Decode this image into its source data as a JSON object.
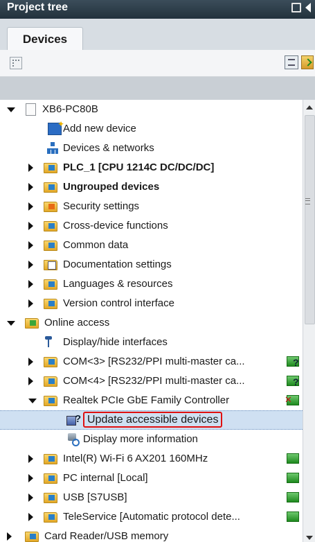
{
  "panel": {
    "title": "Project tree"
  },
  "tabs": [
    {
      "label": "Devices"
    }
  ],
  "tree": [
    {
      "label": "XB6-PC80B",
      "icon": "file-icon",
      "expander": "expanded",
      "bold": false,
      "selected": false,
      "status_icon": null
    },
    {
      "label": "Add new device",
      "icon": "add-device-icon",
      "expander": null,
      "bold": false,
      "selected": false,
      "status_icon": null
    },
    {
      "label": "Devices & networks",
      "icon": "network-icon",
      "expander": null,
      "bold": false,
      "selected": false,
      "status_icon": null
    },
    {
      "label": "PLC_1 [CPU 1214C DC/DC/DC]",
      "icon": "plc-icon",
      "expander": "collapsed",
      "bold": true,
      "selected": false,
      "status_icon": null
    },
    {
      "label": "Ungrouped devices",
      "icon": "ungrouped-devices-icon",
      "expander": "collapsed",
      "bold": true,
      "selected": false,
      "status_icon": null
    },
    {
      "label": "Security settings",
      "icon": "security-icon",
      "expander": "collapsed",
      "bold": false,
      "selected": false,
      "status_icon": null
    },
    {
      "label": "Cross-device functions",
      "icon": "cross-device-icon",
      "expander": "collapsed",
      "bold": false,
      "selected": false,
      "status_icon": null
    },
    {
      "label": "Common data",
      "icon": "common-data-icon",
      "expander": "collapsed",
      "bold": false,
      "selected": false,
      "status_icon": null
    },
    {
      "label": "Documentation settings",
      "icon": "documentation-icon",
      "expander": "collapsed",
      "bold": false,
      "selected": false,
      "status_icon": null
    },
    {
      "label": "Languages & resources",
      "icon": "languages-icon",
      "expander": "collapsed",
      "bold": false,
      "selected": false,
      "status_icon": null
    },
    {
      "label": "Version control interface",
      "icon": "version-control-icon",
      "expander": "collapsed",
      "bold": false,
      "selected": false,
      "status_icon": null
    },
    {
      "label": "Online access",
      "icon": "online-access-icon",
      "expander": "expanded",
      "bold": false,
      "selected": false,
      "status_icon": null
    },
    {
      "label": "Display/hide interfaces",
      "icon": "interface-icon",
      "expander": null,
      "bold": false,
      "selected": false,
      "status_icon": null
    },
    {
      "label": "COM<3> [RS232/PPI multi-master ca...",
      "icon": "folder-icon",
      "expander": "collapsed",
      "bold": false,
      "selected": false,
      "status_icon": "unknown-status-icon"
    },
    {
      "label": "COM<4> [RS232/PPI multi-master ca...",
      "icon": "folder-icon",
      "expander": "collapsed",
      "bold": false,
      "selected": false,
      "status_icon": "unknown-status-icon"
    },
    {
      "label": "Realtek PCIe GbE Family Controller",
      "icon": "folder-icon",
      "expander": "expanded",
      "bold": false,
      "selected": false,
      "status_icon": "disconnected-status-icon"
    },
    {
      "label": "Update accessible devices",
      "icon": "update-devices-icon",
      "expander": null,
      "bold": false,
      "selected": true,
      "status_icon": null
    },
    {
      "label": "Display more information",
      "icon": "info-icon",
      "expander": null,
      "bold": false,
      "selected": false,
      "status_icon": null
    },
    {
      "label": "Intel(R) Wi-Fi 6 AX201 160MHz",
      "icon": "folder-icon",
      "expander": "collapsed",
      "bold": false,
      "selected": false,
      "status_icon": "connected-status-icon"
    },
    {
      "label": "PC internal [Local]",
      "icon": "folder-icon",
      "expander": "collapsed",
      "bold": false,
      "selected": false,
      "status_icon": "connected-status-icon"
    },
    {
      "label": "USB [S7USB]",
      "icon": "folder-icon",
      "expander": "collapsed",
      "bold": false,
      "selected": false,
      "status_icon": "connected-status-icon"
    },
    {
      "label": "TeleService [Automatic protocol dete...",
      "icon": "folder-icon",
      "expander": "collapsed",
      "bold": false,
      "selected": false,
      "status_icon": "connected-status-icon"
    },
    {
      "label": "Card Reader/USB memory",
      "icon": "card-reader-icon",
      "expander": "collapsed",
      "bold": false,
      "selected": false,
      "status_icon": null
    }
  ],
  "colors": {
    "title_bar": "#2d3e4a",
    "selection": "#cfe0f2",
    "highlight_border": "#e01010",
    "status_green": "#1e8a1e"
  }
}
